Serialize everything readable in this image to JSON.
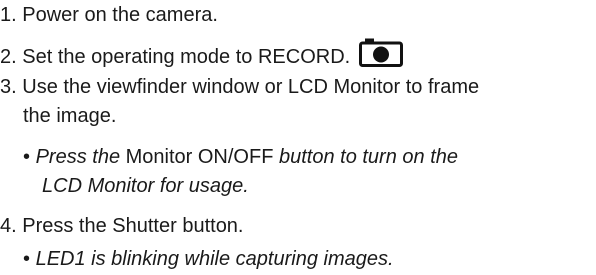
{
  "steps": [
    {
      "number": "1.",
      "text": "Power on the camera."
    },
    {
      "number": "2.",
      "text": "Set the operating mode to RECORD.",
      "icon": "camera-icon"
    },
    {
      "number": "3.",
      "line1": "Use the viewfinder window or LCD Monitor to frame",
      "line2": "the image.",
      "bullet": {
        "symbol": "•",
        "italic_1": "Press the",
        "normal": " Monitor ON/OFF ",
        "italic_2": "button to turn on the",
        "italic_line2": "LCD Monitor for usage."
      }
    },
    {
      "number": "4.",
      "text": "Press the Shutter button.",
      "bullet": {
        "symbol": "•",
        "italic": "LED1 is blinking while capturing images."
      }
    }
  ]
}
